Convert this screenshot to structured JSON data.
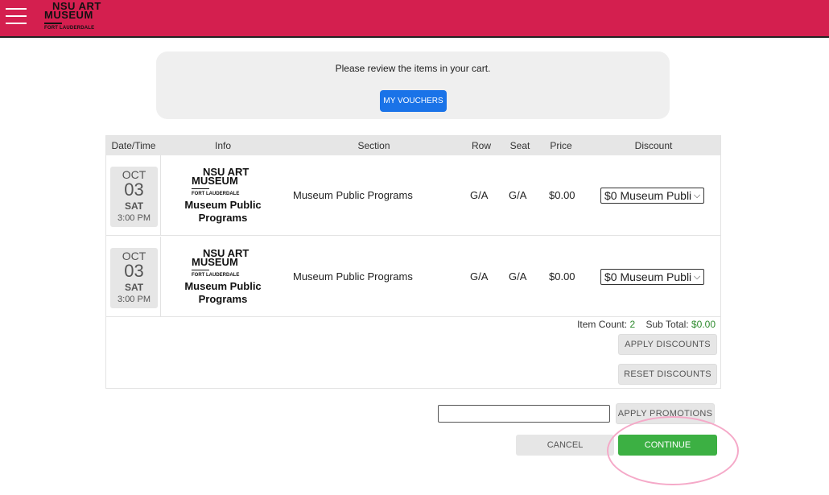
{
  "header": {
    "logo": {
      "line1": "NSU ART",
      "line2": "MUSEUM",
      "line3": "FORT LAUDERDALE"
    },
    "menu_icon": "hamburger-icon",
    "color": "#d41f4f"
  },
  "review": {
    "message": "Please review the items in your cart.",
    "vouchers_label": "MY VOUCHERS"
  },
  "table": {
    "columns": [
      "Date/Time",
      "Info",
      "Section",
      "Row",
      "Seat",
      "Price",
      "Discount"
    ],
    "rows": [
      {
        "month": "OCT",
        "day": "03",
        "weekday": "SAT",
        "time": "3:00 PM",
        "logo": {
          "line1": "NSU ART",
          "line2": "MUSEUM",
          "line3": "FORT LAUDERDALE"
        },
        "event": "Museum Public Programs",
        "section": "Museum Public Programs",
        "row": "G/A",
        "seat": "G/A",
        "price": "$0.00",
        "discount": "$0 Museum Public"
      },
      {
        "month": "OCT",
        "day": "03",
        "weekday": "SAT",
        "time": "3:00 PM",
        "logo": {
          "line1": "NSU ART",
          "line2": "MUSEUM",
          "line3": "FORT LAUDERDALE"
        },
        "event": "Museum Public Programs",
        "section": "Museum Public Programs",
        "row": "G/A",
        "seat": "G/A",
        "price": "$0.00",
        "discount": "$0 Museum Public"
      }
    ]
  },
  "totals": {
    "item_count_label": "Item Count:",
    "item_count": "2",
    "subtotal_label": "Sub Total:",
    "subtotal": "$0.00"
  },
  "buttons": {
    "apply_discounts": "APPLY DISCOUNTS",
    "reset_discounts": "RESET DISCOUNTS",
    "apply_promotions": "APPLY PROMOTIONS",
    "cancel": "CANCEL",
    "continue": "CONTINUE"
  },
  "promo": {
    "value": ""
  },
  "colors": {
    "accent_blue": "#1a73e8",
    "continue_green": "#3cb043",
    "highlight_pink": "#f5a9c8"
  }
}
